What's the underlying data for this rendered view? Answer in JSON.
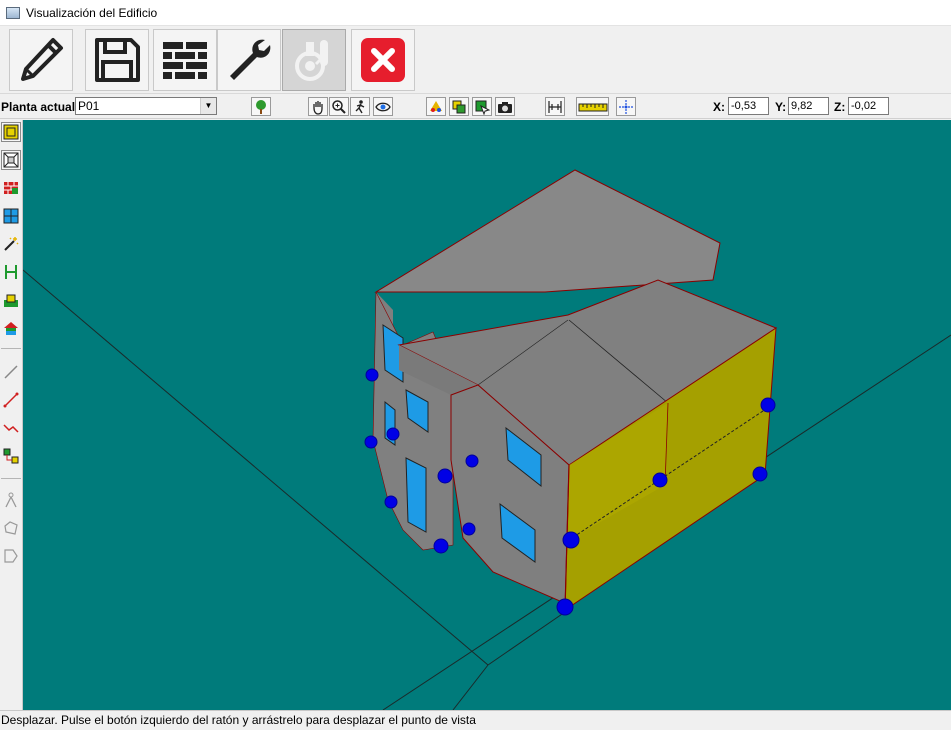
{
  "window": {
    "title": "Visualización del Edificio"
  },
  "main_toolbar": {
    "buttons": [
      {
        "icon": "pencil-icon"
      },
      {
        "icon": "save-icon"
      },
      {
        "icon": "brick-wall-icon"
      },
      {
        "icon": "wrench-icon"
      },
      {
        "icon": "thermometer-icon",
        "disabled": true
      },
      {
        "icon": "close-icon",
        "color": "#e61e2d"
      }
    ]
  },
  "view_toolbar": {
    "planta_label": "Planta actual",
    "planta_value": "P01",
    "coords": {
      "x_label": "X:",
      "x_value": "-0,53",
      "y_label": "Y:",
      "y_value": "9,82",
      "z_label": "Z:",
      "z_value": "-0,02"
    }
  },
  "status": {
    "text": "Desplazar. Pulse el botón izquierdo del ratón y arrástrelo para desplazar el punto de vista"
  },
  "colors": {
    "viewport_bg": "#007b7b",
    "roof": "#808080",
    "wall_side": "#8a8700",
    "window": "#1e9be6",
    "marker": "#0000e6",
    "edge": "#a00000"
  }
}
